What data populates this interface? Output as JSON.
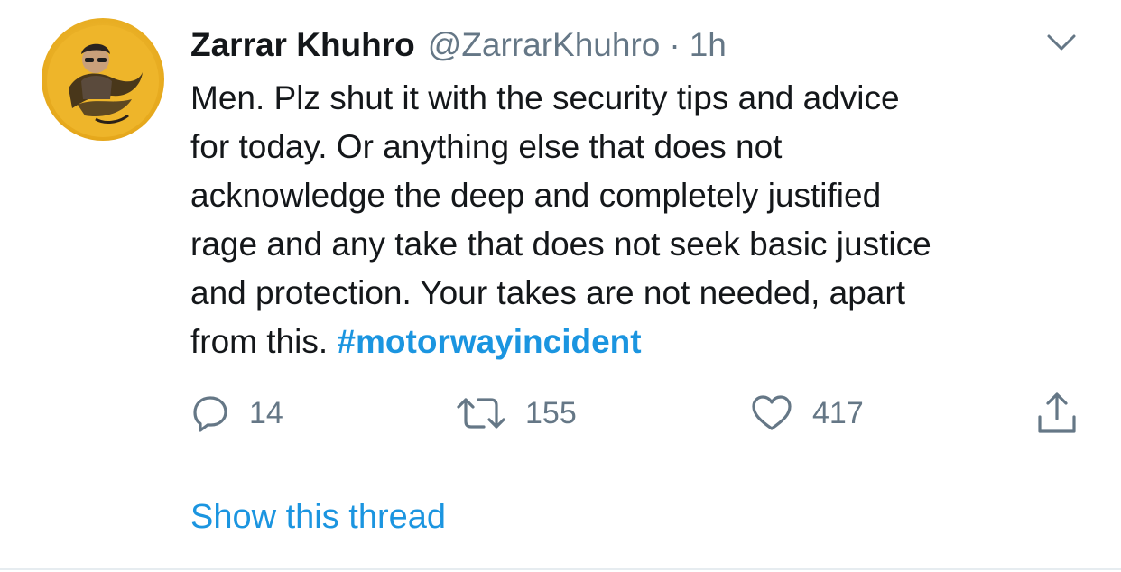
{
  "author": {
    "display_name": "Zarrar Khuhro",
    "handle": "@ZarrarKhuhro",
    "separator": "·",
    "time": "1h"
  },
  "tweet": {
    "lines": [
      "Men. Plz shut it with the security tips and advice",
      "for today. Or anything else that does not",
      "acknowledge the deep and completely justified",
      "rage and any take that does not seek basic justice",
      "and protection. Your takes are not needed, apart"
    ],
    "last_line_prefix": "from this.",
    "hashtag": "#motorwayincident"
  },
  "actions": {
    "reply_count": "14",
    "retweet_count": "155",
    "like_count": "417",
    "reply_icon": "reply-icon",
    "retweet_icon": "retweet-icon",
    "like_icon": "heart-icon",
    "share_icon": "share-icon"
  },
  "show_thread_label": "Show this thread",
  "colors": {
    "text": "#14171a",
    "secondary": "#657786",
    "link": "#1b95e0",
    "divider": "#e6ecf0"
  }
}
